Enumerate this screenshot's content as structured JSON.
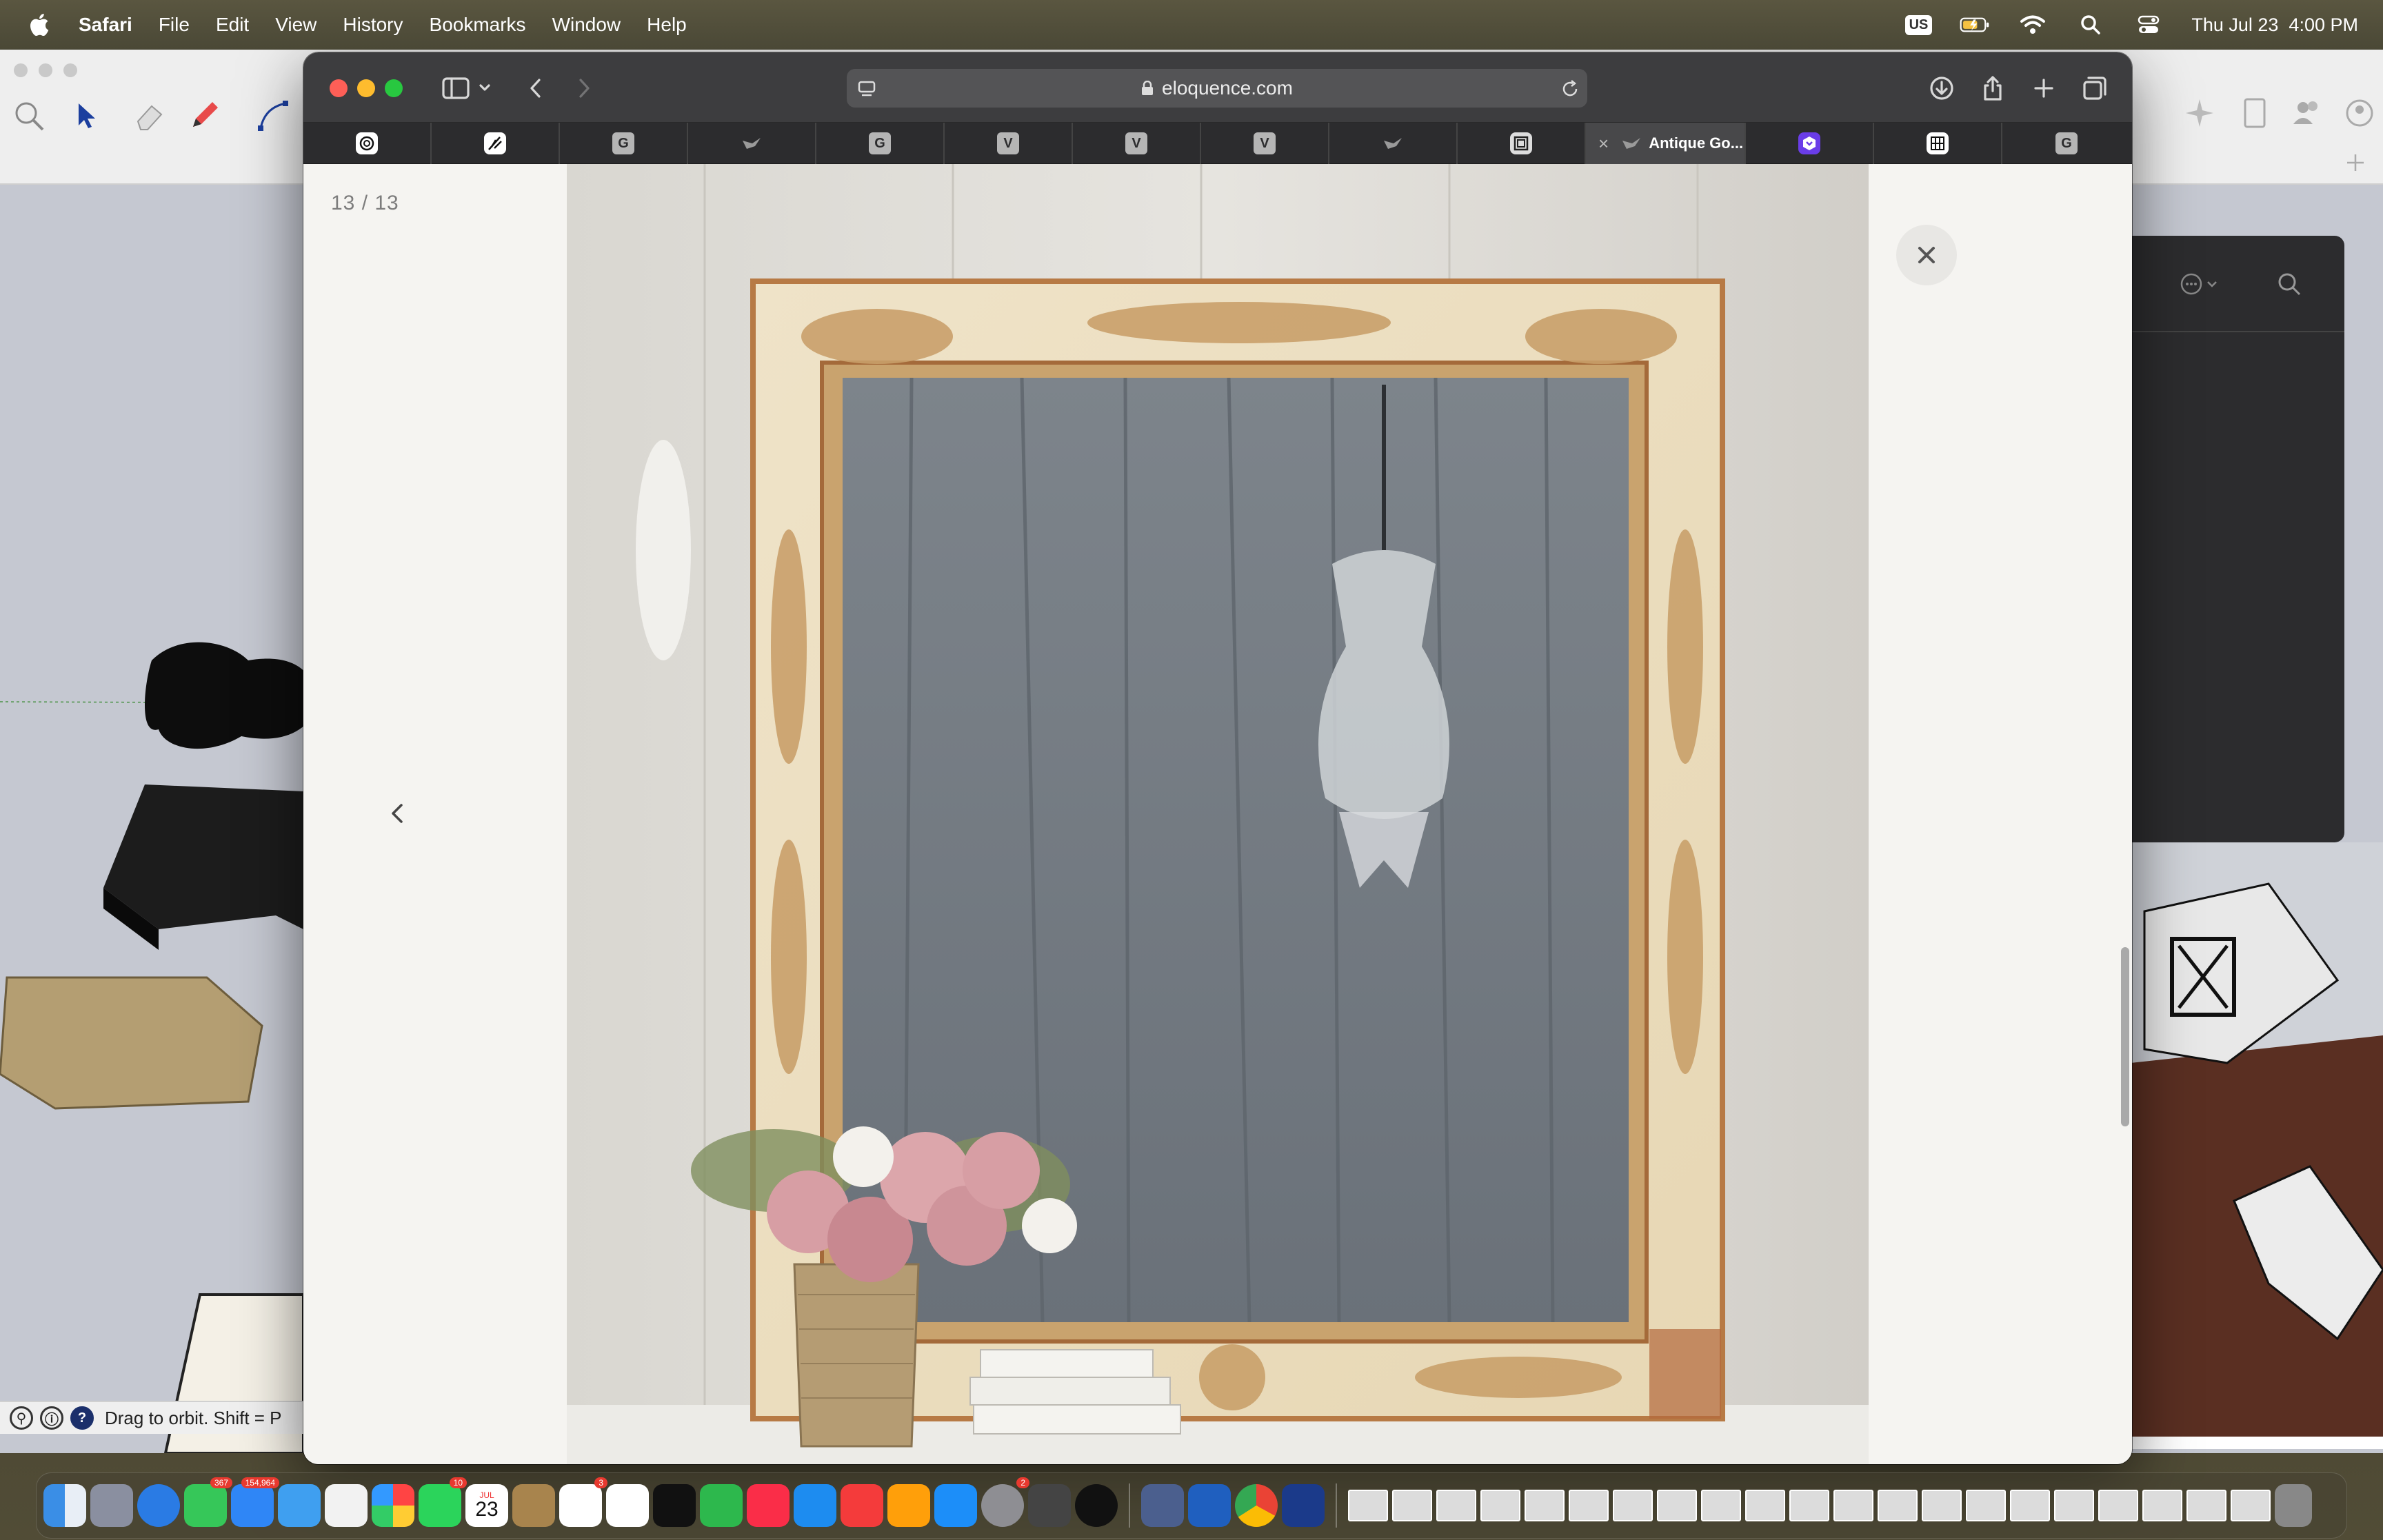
{
  "menubar": {
    "app_name": "Safari",
    "menus": [
      "File",
      "Edit",
      "View",
      "History",
      "Bookmarks",
      "Window",
      "Help"
    ],
    "input_source": "US",
    "datetime": "Thu Jul 23  4:00 PM"
  },
  "background_app": {
    "status_text": "Drag to orbit. Shift = P"
  },
  "safari": {
    "url": "eloquence.com",
    "tabs": [
      {
        "icon": "openai-icon",
        "glyph": ""
      },
      {
        "icon": "feather-icon",
        "glyph": ""
      },
      {
        "icon": "g-favicon",
        "glyph": "G"
      },
      {
        "icon": "bird-icon",
        "glyph": ""
      },
      {
        "icon": "g-favicon",
        "glyph": "G"
      },
      {
        "icon": "v-favicon",
        "glyph": "V"
      },
      {
        "icon": "v-favicon",
        "glyph": "V"
      },
      {
        "icon": "v-favicon",
        "glyph": "V"
      },
      {
        "icon": "bird-icon",
        "glyph": ""
      },
      {
        "icon": "frame-icon",
        "glyph": ""
      },
      {
        "icon": "bird-icon",
        "glyph": "",
        "label": "Antique Go...",
        "active": true
      },
      {
        "icon": "shield-icon",
        "glyph": ""
      },
      {
        "icon": "grid-icon",
        "glyph": ""
      },
      {
        "icon": "g-favicon",
        "glyph": "G"
      }
    ]
  },
  "lightbox": {
    "counter": "13 / 13"
  },
  "dock": {
    "badges": {
      "messages": "367",
      "mail": "154,964",
      "facetime": "10",
      "calendar_month": "JUL",
      "calendar_day": "23",
      "reminders": "3",
      "settings": "2"
    }
  },
  "colors": {
    "accent_red": "#fe5f57",
    "accent_yellow": "#febc2e",
    "accent_green": "#28c840"
  }
}
